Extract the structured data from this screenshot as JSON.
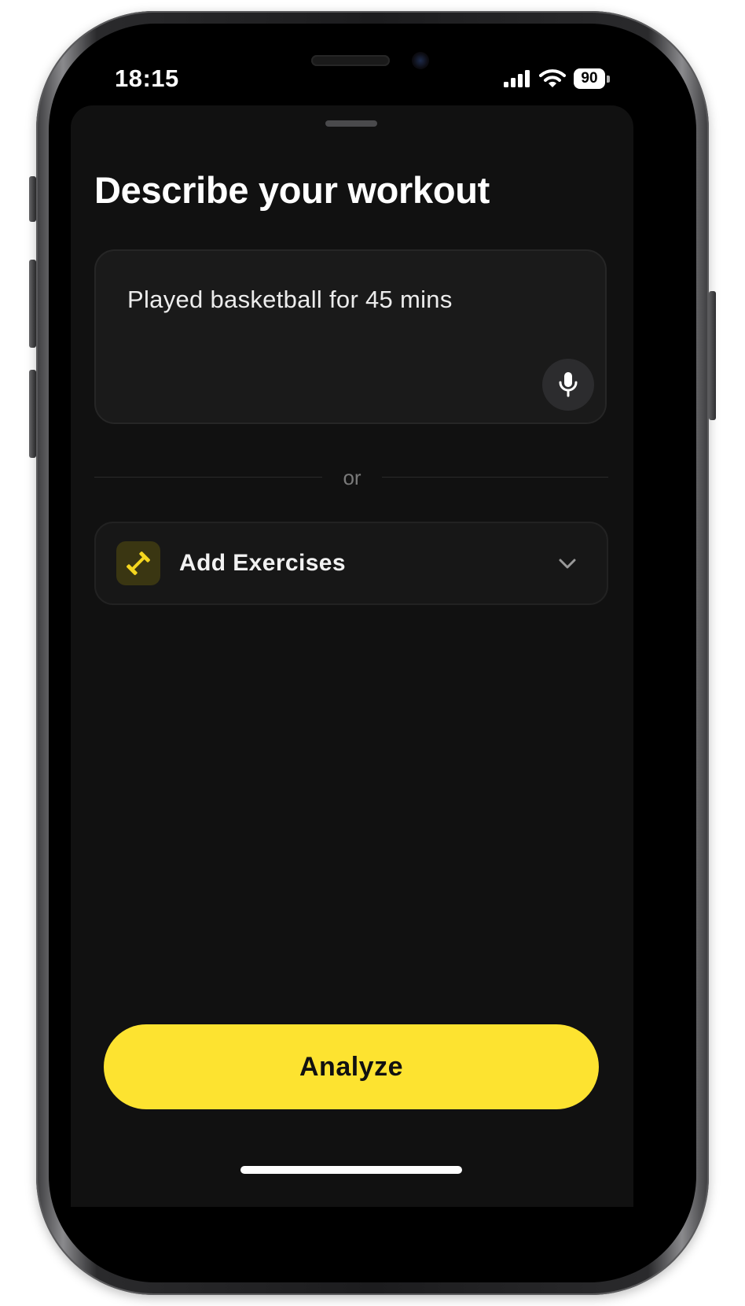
{
  "status_bar": {
    "time": "18:15",
    "battery_level": "90",
    "signal_icon": "cellular-signal-icon",
    "wifi_icon": "wifi-icon"
  },
  "sheet": {
    "title": "Describe your workout",
    "input": {
      "value": "Played basketball for 45 mins",
      "mic_icon": "microphone-icon"
    },
    "divider_text": "or",
    "add_exercises": {
      "label": "Add Exercises",
      "icon": "dumbbell-icon",
      "chevron_icon": "chevron-down-icon"
    },
    "analyze_label": "Analyze"
  },
  "colors": {
    "accent": "#fde330",
    "sheet_background": "#111111",
    "card_background": "#1a1a1a",
    "text_primary": "#ffffff",
    "text_muted": "#7a7a7a"
  }
}
